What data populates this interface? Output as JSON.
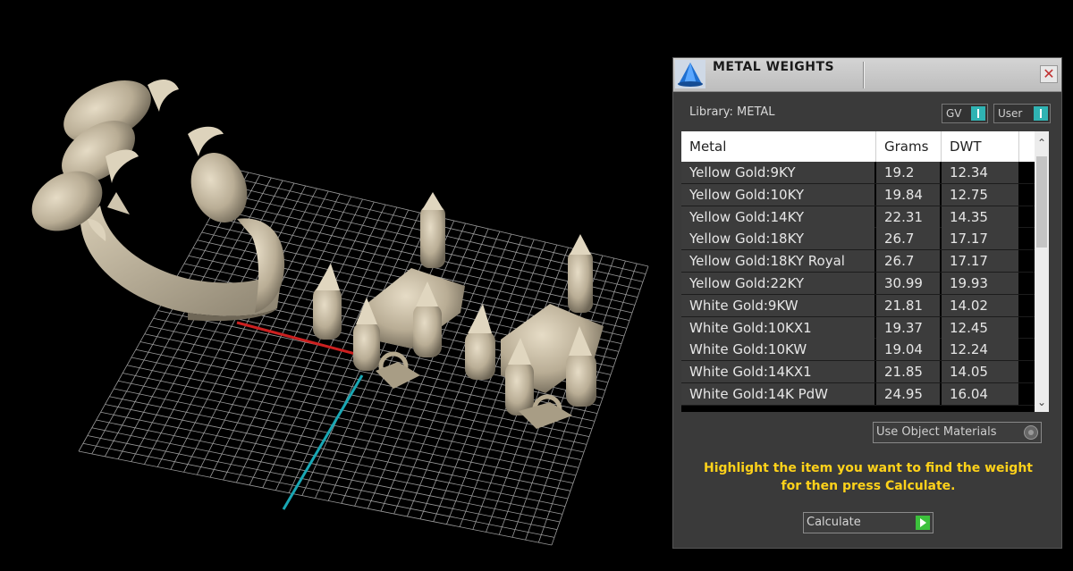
{
  "dialog": {
    "title": "METAL WEIGHTS",
    "close_glyph": "✕",
    "library_label": "Library: METAL",
    "toggles": {
      "gv": "GV",
      "user": "User"
    },
    "table": {
      "headers": {
        "metal": "Metal",
        "grams": "Grams",
        "dwt": "DWT"
      },
      "rows": [
        {
          "metal": "Yellow Gold:9KY",
          "grams": "19.2",
          "dwt": "12.34"
        },
        {
          "metal": "Yellow Gold:10KY",
          "grams": "19.84",
          "dwt": "12.75"
        },
        {
          "metal": "Yellow Gold:14KY",
          "grams": "22.31",
          "dwt": "14.35"
        },
        {
          "metal": "Yellow Gold:18KY",
          "grams": "26.7",
          "dwt": "17.17"
        },
        {
          "metal": "Yellow Gold:18KY Royal",
          "grams": "26.7",
          "dwt": "17.17"
        },
        {
          "metal": "Yellow Gold:22KY",
          "grams": "30.99",
          "dwt": "19.93"
        },
        {
          "metal": "White Gold:9KW",
          "grams": "21.81",
          "dwt": "14.02"
        },
        {
          "metal": "White Gold:10KX1",
          "grams": "19.37",
          "dwt": "12.45"
        },
        {
          "metal": "White Gold:10KW",
          "grams": "19.04",
          "dwt": "12.24"
        },
        {
          "metal": "White Gold:14KX1",
          "grams": "21.85",
          "dwt": "14.05"
        },
        {
          "metal": "White Gold:14K PdW",
          "grams": "24.95",
          "dwt": "16.04"
        }
      ],
      "scroll_up_glyph": "⌃",
      "scroll_down_glyph": "⌄"
    },
    "use_object_materials_label": "Use Object Materials",
    "hint_line1": "Highlight the item you want to find the weight",
    "hint_line2": "for then press Calculate.",
    "calculate_label": "Calculate",
    "colors": {
      "hint": "#ffd21a",
      "toggle_accent": "#2fb3b3",
      "go_accent": "#3cc13c"
    },
    "icons": [
      "app-icon",
      "close-icon",
      "toggle-switch-icon",
      "scroll-up-icon",
      "scroll-down-icon",
      "radio-icon",
      "go-arrow-icon"
    ]
  },
  "viewport": {
    "axis_colors": {
      "x": "#cc2020",
      "y": "#19a7b4"
    },
    "model_color": "#c2b6a0"
  }
}
